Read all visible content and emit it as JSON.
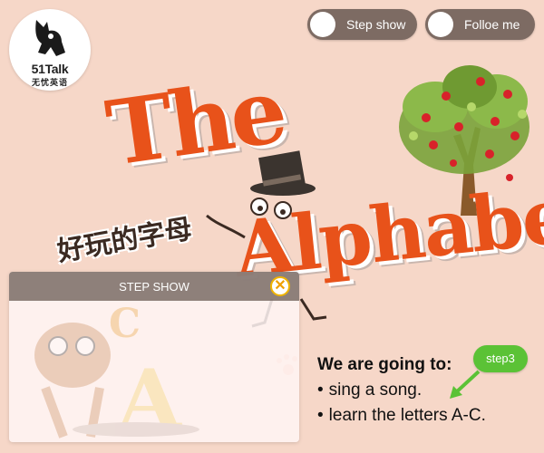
{
  "logo": {
    "brand": "51Talk",
    "brand_sub": "无忧英语"
  },
  "header": {
    "step_show_label": "Step show",
    "follow_me_label": "Folloe me"
  },
  "title": {
    "line1": "The",
    "line2": "Alphabet",
    "subtitle_cn": "好玩的字母"
  },
  "panel": {
    "title": "STEP SHOW",
    "close_glyph": "✕"
  },
  "goals": {
    "heading": "We are going to:",
    "items": [
      "sing a song.",
      "learn the letters A-C."
    ],
    "bullet": "•"
  },
  "step_badge": "step3",
  "colors": {
    "background": "#f6d7c8",
    "title_orange": "#e8521a",
    "pill": "#7d6b63",
    "step_green": "#5bc236"
  }
}
